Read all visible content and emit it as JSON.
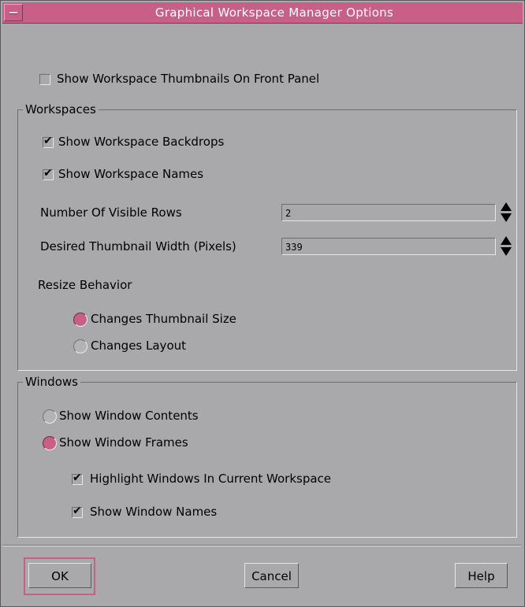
{
  "window": {
    "title": "Graphical Workspace Manager Options"
  },
  "front_panel": {
    "show_thumbnails_label": "Show Workspace Thumbnails On Front Panel",
    "show_thumbnails_checked": false
  },
  "workspaces": {
    "group_label": "Workspaces",
    "show_backdrops_label": "Show Workspace Backdrops",
    "show_backdrops_checked": true,
    "show_names_label": "Show Workspace Names",
    "show_names_checked": true,
    "rows_label": "Number Of Visible Rows",
    "rows_value": "2",
    "width_label": "Desired Thumbnail Width (Pixels)",
    "width_value": "339",
    "resize_label": "Resize Behavior",
    "resize_options": [
      {
        "label": "Changes Thumbnail Size",
        "selected": true
      },
      {
        "label": "Changes Layout",
        "selected": false
      }
    ]
  },
  "windows": {
    "group_label": "Windows",
    "mode_options": [
      {
        "label": "Show Window Contents",
        "selected": false
      },
      {
        "label": "Show Window Frames",
        "selected": true
      }
    ],
    "highlight_label": "Highlight Windows In Current Workspace",
    "highlight_checked": true,
    "show_window_names_label": "Show Window Names",
    "show_window_names_checked": true
  },
  "buttons": {
    "ok": "OK",
    "cancel": "Cancel",
    "help": "Help"
  },
  "colors": {
    "accent": "#c85f86",
    "background": "#a9a9ac"
  }
}
